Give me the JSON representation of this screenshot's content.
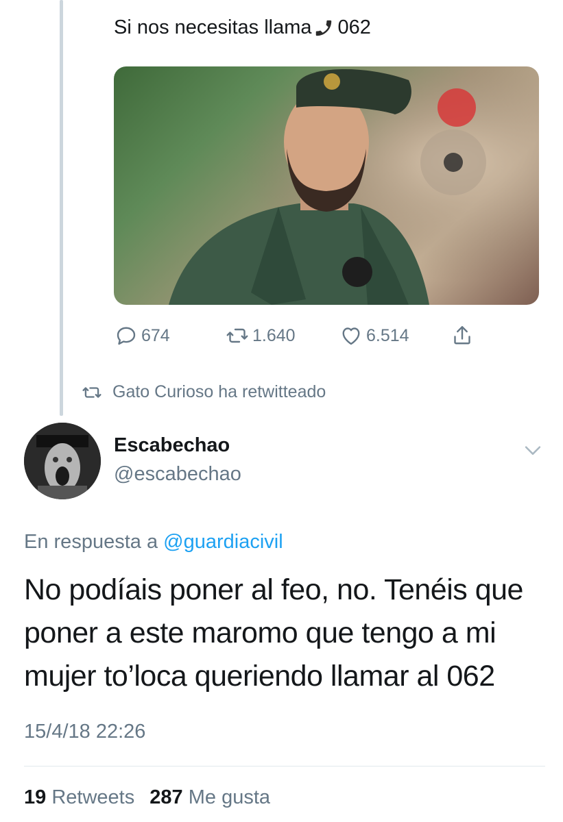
{
  "previous_tweet": {
    "text_before_icon": "Si nos necesitas llama",
    "icon": "phone-receiver-icon",
    "text_after_icon": "062",
    "image_icon": "guardia-civil-photo",
    "actions": {
      "replies": "674",
      "retweets": "1.640",
      "likes": "6.514",
      "share_icon": "share-icon"
    }
  },
  "retweet_context": {
    "icon": "retweet-icon",
    "text": "Gato Curioso ha retwitteado"
  },
  "tweet": {
    "author": {
      "name": "Escabechao",
      "handle": "@escabechao"
    },
    "reply_prefix": "En respuesta a ",
    "reply_handle": "@guardiacivil",
    "text": "No podíais poner al feo, no. Tenéis que poner a este maromo que tengo a mi mujer to’loca queriendo llamar al 062",
    "date": "15/4/18 22:26",
    "stats": {
      "retweets_count": "19",
      "retweets_label": "Retweets",
      "likes_count": "287",
      "likes_label": "Me gusta"
    }
  },
  "colors": {
    "text": "#14171a",
    "muted": "#657786",
    "link": "#1da1f2",
    "thread_line": "#ccd6dd"
  }
}
